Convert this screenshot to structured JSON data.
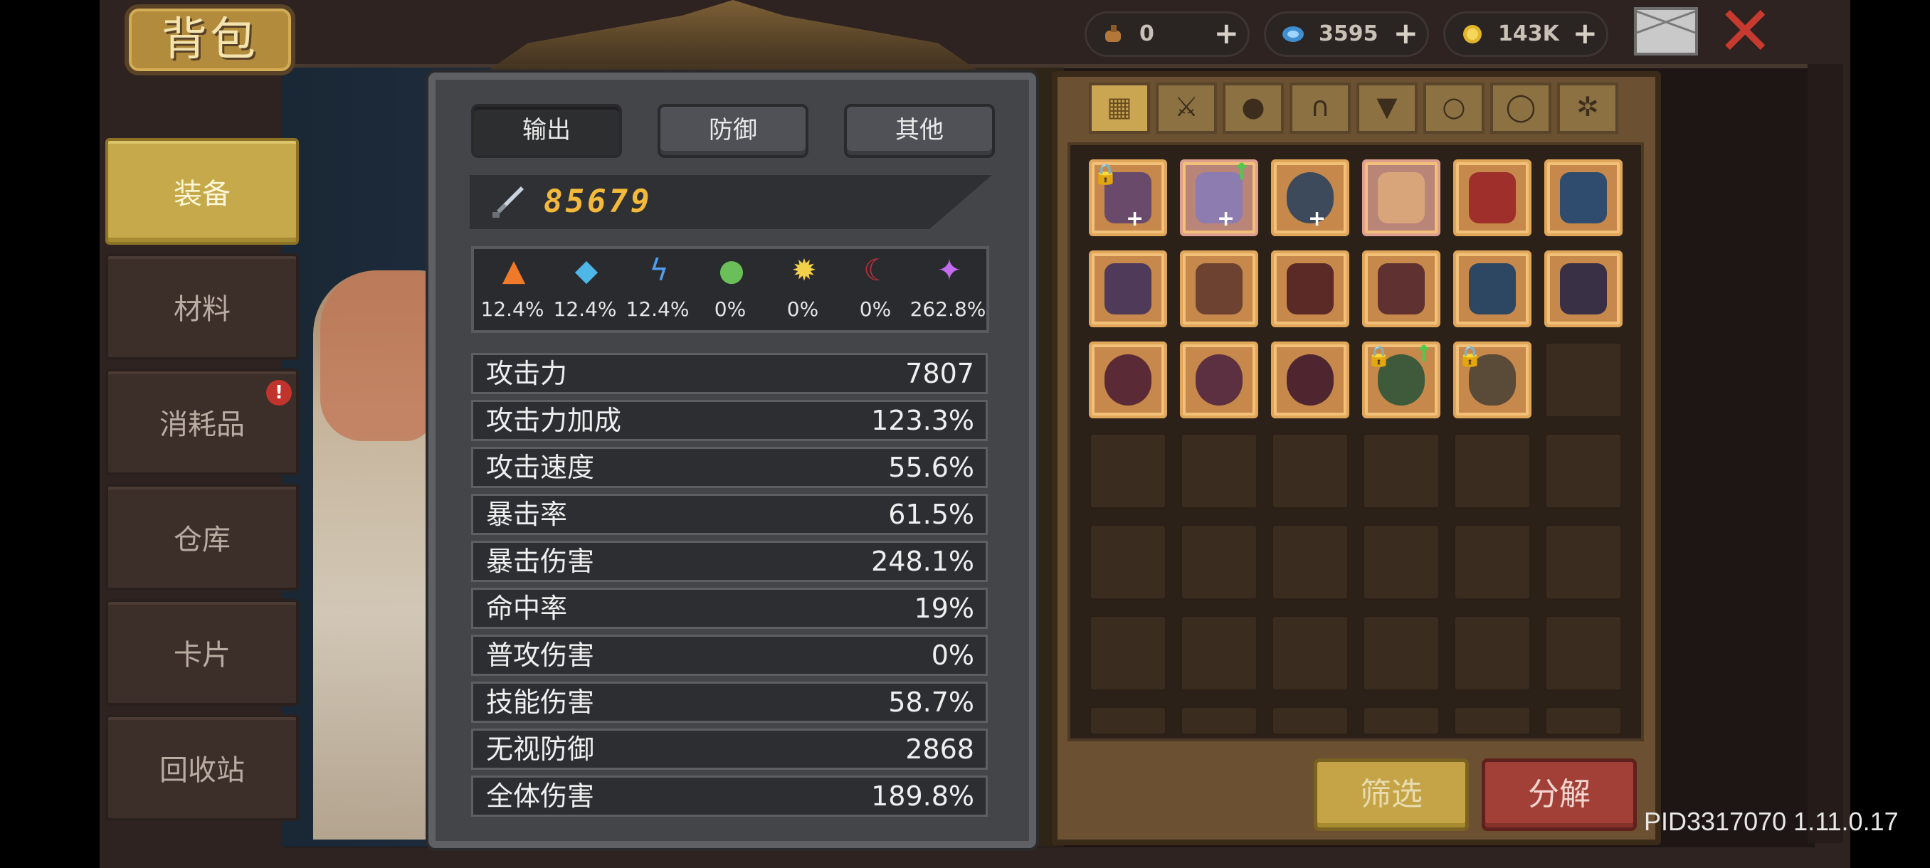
{
  "title": "背包",
  "currencies": [
    {
      "icon": "key-icon",
      "value": "0",
      "plus": "+"
    },
    {
      "icon": "gem-icon",
      "value": "3595",
      "plus": "+"
    },
    {
      "icon": "gold-coin-icon",
      "value": "143K",
      "plus": "+"
    }
  ],
  "nav": [
    {
      "label": "装备",
      "active": true
    },
    {
      "label": "材料",
      "active": false
    },
    {
      "label": "消耗品",
      "active": false,
      "badge": "!"
    },
    {
      "label": "仓库",
      "active": false
    },
    {
      "label": "卡片",
      "active": false
    },
    {
      "label": "回收站",
      "active": false
    }
  ],
  "tabs": [
    {
      "label": "输出",
      "active": true
    },
    {
      "label": "防御",
      "active": false
    },
    {
      "label": "其他",
      "active": false
    }
  ],
  "power": {
    "icon": "sword-icon",
    "value": "85679"
  },
  "elements": [
    {
      "icon": "fire-icon",
      "value": "12.4%",
      "color": "#f07a2a"
    },
    {
      "icon": "ice-crystal-icon",
      "value": "12.4%",
      "color": "#4fb6e8"
    },
    {
      "icon": "lightning-icon",
      "value": "12.4%",
      "color": "#4f9ef0"
    },
    {
      "icon": "poison-skull-icon",
      "value": "0%",
      "color": "#6bbf59"
    },
    {
      "icon": "light-sun-icon",
      "value": "0%",
      "color": "#f2d04a"
    },
    {
      "icon": "dark-moon-icon",
      "value": "0%",
      "color": "#c0303a"
    },
    {
      "icon": "void-star-icon",
      "value": "262.8%",
      "color": "#c36cf0"
    }
  ],
  "stats": [
    {
      "name": "攻击力",
      "value": "7807"
    },
    {
      "name": "攻击力加成",
      "value": "123.3%"
    },
    {
      "name": "攻击速度",
      "value": "55.6%"
    },
    {
      "name": "暴击率",
      "value": "61.5%"
    },
    {
      "name": "暴击伤害",
      "value": "248.1%"
    },
    {
      "name": "命中率",
      "value": "19%"
    },
    {
      "name": "普攻伤害",
      "value": "0%"
    },
    {
      "name": "技能伤害",
      "value": "58.7%"
    },
    {
      "name": "无视防御",
      "value": "2868"
    },
    {
      "name": "全体伤害",
      "value": "189.8%"
    }
  ],
  "categories": [
    "grid-icon",
    "sword-icon",
    "pet-icon",
    "helmet-icon",
    "armor-icon",
    "necklace-icon",
    "ring-icon",
    "gear-icon"
  ],
  "inventory": [
    {
      "icon": "accessory-item-icon",
      "locked": true,
      "plus": true,
      "upgrade": false
    },
    {
      "icon": "crossbow-item-icon",
      "locked": false,
      "plus": true,
      "upgrade": true
    },
    {
      "icon": "amulet-item-icon",
      "locked": false,
      "plus": true,
      "upgrade": false
    },
    {
      "icon": "scroll-item-icon",
      "locked": false,
      "plus": false,
      "upgrade": false
    },
    {
      "icon": "helmet-item-icon",
      "locked": false,
      "plus": false,
      "upgrade": false
    },
    {
      "icon": "gauntlet-item-icon",
      "locked": false,
      "plus": false,
      "upgrade": false
    },
    {
      "icon": "armor-item-icon",
      "locked": false,
      "plus": false,
      "upgrade": false
    },
    {
      "icon": "helmet-item-icon",
      "locked": false,
      "plus": false,
      "upgrade": false
    },
    {
      "icon": "armor-item-icon",
      "locked": false,
      "plus": false,
      "upgrade": false
    },
    {
      "icon": "boots-item-icon",
      "locked": false,
      "plus": false,
      "upgrade": false
    },
    {
      "icon": "armor-item-icon",
      "locked": false,
      "plus": false,
      "upgrade": false
    },
    {
      "icon": "gauntlet-item-icon",
      "locked": false,
      "plus": false,
      "upgrade": false
    },
    {
      "icon": "ring-item-icon",
      "locked": false,
      "plus": false,
      "upgrade": false
    },
    {
      "icon": "ring-item-icon",
      "locked": false,
      "plus": false,
      "upgrade": false
    },
    {
      "icon": "ring-item-icon",
      "locked": false,
      "plus": false,
      "upgrade": false
    },
    {
      "icon": "relic-item-icon",
      "locked": true,
      "plus": false,
      "upgrade": true
    },
    {
      "icon": "compass-item-icon",
      "locked": true,
      "plus": false,
      "upgrade": false
    }
  ],
  "buttons": {
    "filter": "筛选",
    "decompose": "分解"
  },
  "version": "PID3317070 1.11.0.17"
}
